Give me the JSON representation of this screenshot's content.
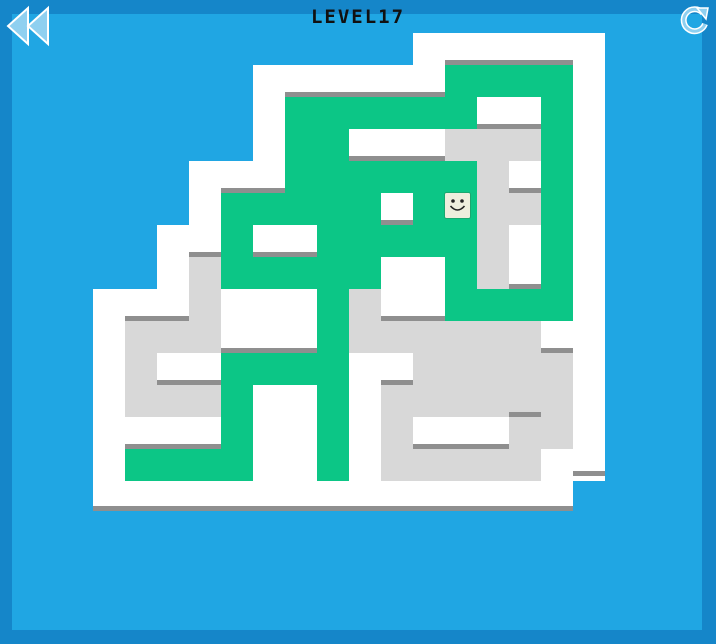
{
  "level_label": "LEVEL17",
  "buttons": {
    "back": {
      "icon": "double-left-arrow-icon"
    },
    "restart": {
      "icon": "restart-icon"
    }
  },
  "colors": {
    "background": "#20a6e3",
    "frame": "#1586c9",
    "wall": "#ffffff",
    "wall_shadow": "#8f8f8f",
    "unpainted_floor": "#d8d8d8",
    "painted_floor": "#0cc686",
    "player_tile": "#eeeedd"
  },
  "player": {
    "icon": "smiley-block-icon",
    "state": "idle"
  }
}
